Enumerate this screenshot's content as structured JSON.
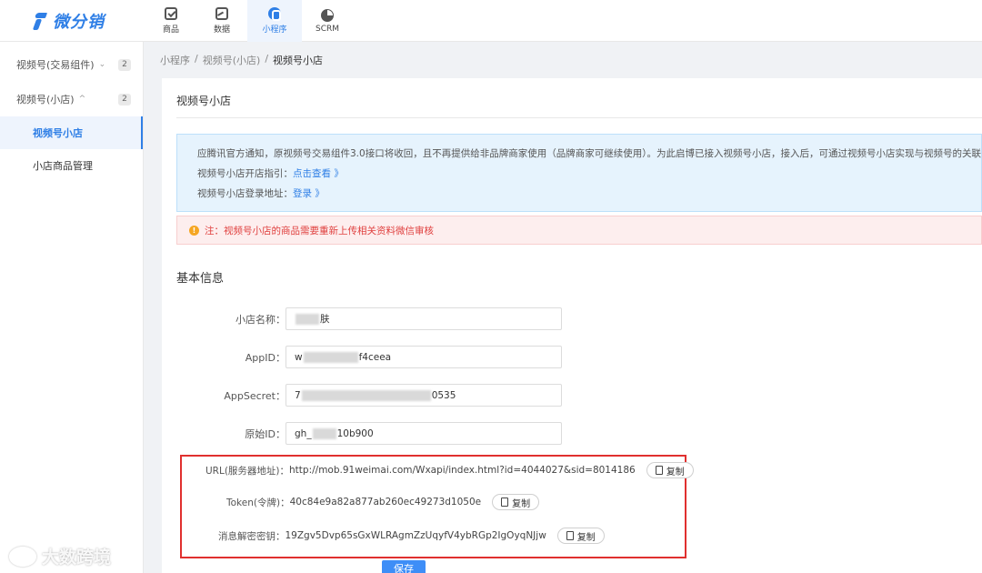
{
  "app": {
    "logo_text": "微分销"
  },
  "nav": {
    "tabs": [
      {
        "label": "商品",
        "icon": "goods-icon"
      },
      {
        "label": "数据",
        "icon": "data-icon"
      },
      {
        "label": "小程序",
        "icon": "mini-program-icon",
        "active": true
      },
      {
        "label": "SCRM",
        "icon": "scrm-icon"
      }
    ]
  },
  "sidebar": {
    "groups": [
      {
        "label": "视频号(交易组件)",
        "chevron": "⌄",
        "badge": "2"
      },
      {
        "label": "视频号(小店)",
        "chevron": "^",
        "badge": "2"
      }
    ],
    "items": [
      {
        "label": "视频号小店",
        "active": true
      },
      {
        "label": "小店商品管理"
      }
    ]
  },
  "breadcrumb": {
    "items": [
      "小程序",
      "视频号(小店)",
      "视频号小店"
    ],
    "separator": "/"
  },
  "panel": {
    "title": "视频号小店",
    "notice": {
      "line1": "应腾讯官方通知，原视频号交易组件3.0接口将收回，且不再提供给非品牌商家使用（品牌商家可继续使用）。为此启博已接入视频号小店，接入后，可通过视频号小店实现与视频号的关联",
      "line2_label": "视频号小店开店指引：",
      "line2_link": "点击查看 》",
      "line3_label": "视频号小店登录地址：",
      "line3_link": "登录 》"
    },
    "warning": {
      "text": "注：视频号小店的商品需要重新上传相关资料微信审核",
      "icon": "!"
    },
    "section_title": "基本信息",
    "form": {
      "shop_name": {
        "label": "小店名称：",
        "value": "肤"
      },
      "appid": {
        "label": "AppID：",
        "prefix": "w",
        "suffix": "f4ceea"
      },
      "appsecret": {
        "label": "AppSecret：",
        "prefix": "7",
        "suffix": "0535"
      },
      "origin_id": {
        "label": "原始ID：",
        "prefix": "gh_",
        "suffix": "10b900"
      }
    },
    "server": {
      "url": {
        "label": "URL(服务器地址)：",
        "value": "http://mob.91weimai.com/Wxapi/index.html?id=4044027&sid=8014186"
      },
      "token": {
        "label": "Token(令牌)：",
        "value": "40c84e9a82a877ab260ec49273d1050e"
      },
      "aes_key": {
        "label": "消息解密密钥：",
        "value": "19Zgv5Dvp65sGxWLRAgmZzUqyfV4ybRGp2IgOyqNJjw"
      },
      "copy_label": "复制"
    },
    "save_label": "保存"
  },
  "watermark": {
    "text": "大数跨境"
  },
  "colors": {
    "accent": "#2f7fe6",
    "warning_text": "#e0403f",
    "highlight_border": "#e0302f"
  }
}
